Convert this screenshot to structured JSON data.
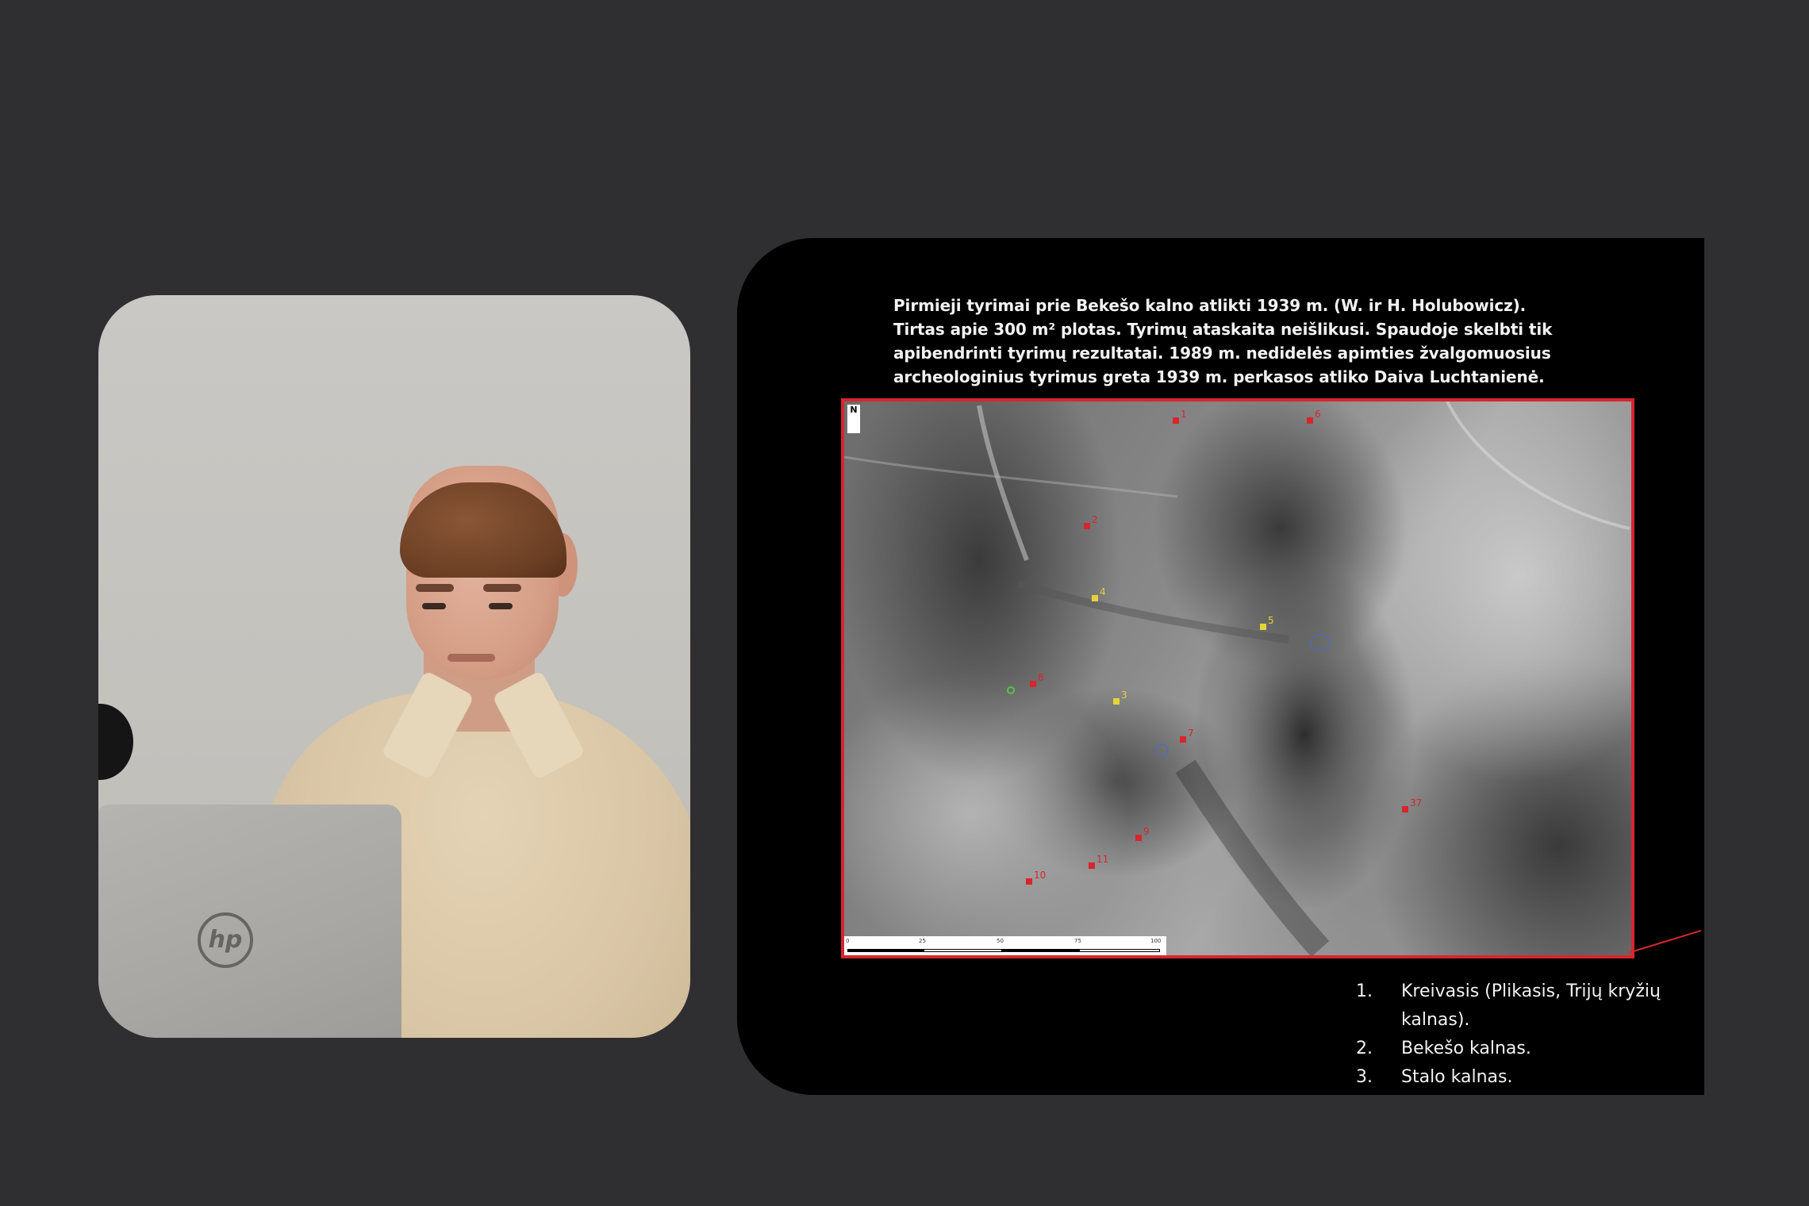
{
  "slide": {
    "paragraph": "Pirmieji tyrimai prie Bekešo kalno atlikti 1939 m.  (W. ir H. Holubowicz). Tirtas apie 300 m² plotas. Tyrimų ataskaita neišlikusi. Spaudoje skelbti tik apibendrinti tyrimų rezultatai. 1989 m. nedidelės apimties žvalgomuosius archeologinius tyrimus greta 1939 m. perkasos atliko Daiva Luchtanienė.",
    "map": {
      "north_label": "N",
      "scale_labels": [
        "0",
        "25",
        "50",
        "75",
        "100"
      ],
      "markers": [
        {
          "label": "1",
          "color": "#d8252c"
        },
        {
          "label": "6",
          "color": "#d8252c"
        },
        {
          "label": "2",
          "color": "#d8252c"
        },
        {
          "label": "4",
          "color": "#e6d23a"
        },
        {
          "label": "5",
          "color": "#e6d23a"
        },
        {
          "label": "8",
          "color": "#d8252c"
        },
        {
          "label": "3",
          "color": "#e6d23a"
        },
        {
          "label": "7",
          "color": "#d8252c"
        },
        {
          "label": "37",
          "color": "#d8252c"
        },
        {
          "label": "9",
          "color": "#d8252c"
        },
        {
          "label": "11",
          "color": "#d8252c"
        },
        {
          "label": "10",
          "color": "#d8252c"
        }
      ]
    },
    "legend": [
      {
        "num": "1.",
        "text": "Kreivasis (Plikasis, Trijų kryžių kalnas)."
      },
      {
        "num": "2.",
        "text": "Bekešo kalnas."
      },
      {
        "num": "3.",
        "text": "Stalo kalnas."
      }
    ]
  },
  "speaker": {
    "laptop_brand": "hp"
  },
  "colors": {
    "background": "#2f2e30",
    "slide_background": "#000000",
    "frame_red": "#d8252c"
  }
}
